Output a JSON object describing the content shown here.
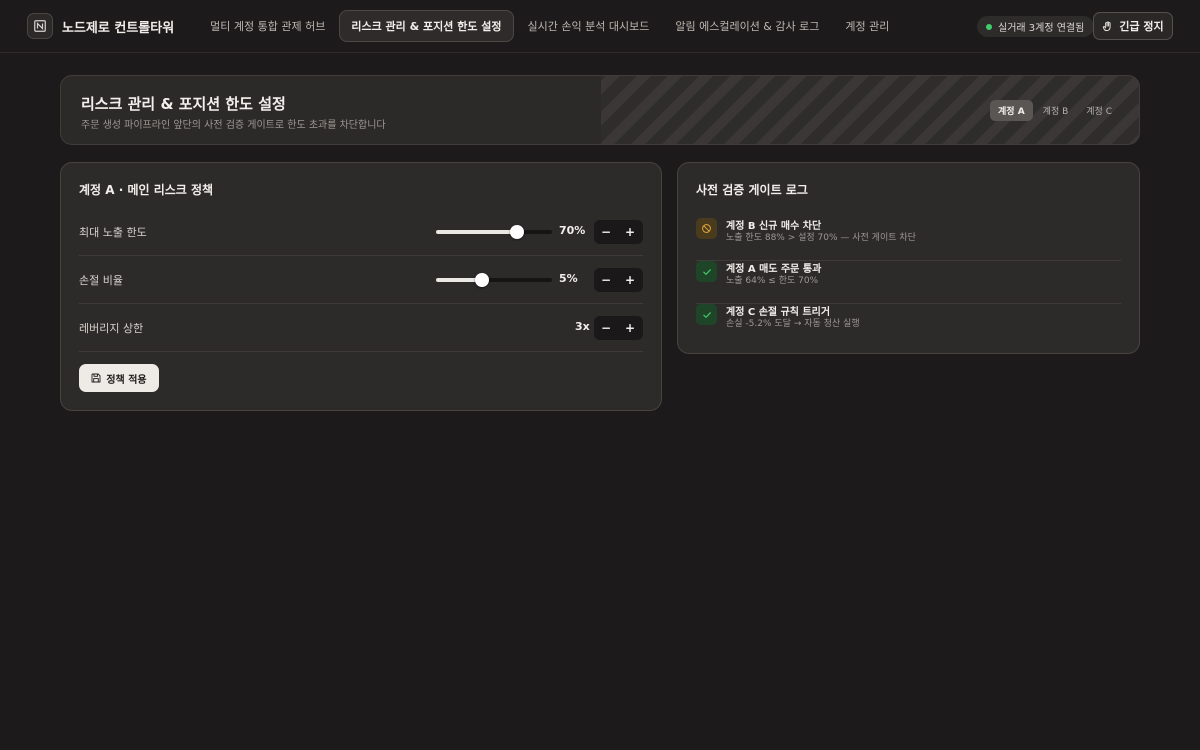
{
  "app": {
    "title": "노드제로 컨트롤타워"
  },
  "nav": {
    "items": [
      {
        "label": "멀티 계정 통합 관제 허브",
        "active": false
      },
      {
        "label": "리스크 관리 & 포지션 한도 설정",
        "active": true
      },
      {
        "label": "실시간 손익 분석 대시보드",
        "active": false
      },
      {
        "label": "알림 에스컬레이션 & 감사 로그",
        "active": false
      },
      {
        "label": "계정 관리",
        "active": false
      }
    ]
  },
  "status": {
    "label": "실거래 3계정 연결됨",
    "color": "#3ecf6a"
  },
  "emergency": {
    "label": "긴급 정지",
    "icon": "hand-stop-icon"
  },
  "header": {
    "title": "리스크 관리 & 포지션 한도 설정",
    "subtitle": "주문 생성 파이프라인 앞단의 사전 검증 게이트로 한도 초과를 차단합니다",
    "account_tabs": [
      {
        "label": "계정 A",
        "active": true
      },
      {
        "label": "계정 B",
        "active": false
      },
      {
        "label": "계정 C",
        "active": false
      }
    ]
  },
  "policy": {
    "title": "계정 A · 메인 리스크 정책",
    "rows": [
      {
        "label": "최대 노출 한도",
        "value": "70%",
        "level": 0.7
      },
      {
        "label": "손절 비율",
        "value": "5%",
        "level": 0.4
      },
      {
        "label": "레버리지 상한",
        "value": "3x"
      }
    ],
    "stepper_minus": "−",
    "stepper_plus": "+",
    "apply_label": "정책 적용",
    "apply_icon": "save-icon"
  },
  "gate_log": {
    "title": "사전 검증 게이트 로그",
    "items": [
      {
        "title": "계정 B 신규 매수 차단",
        "desc": "노출 한도 88% > 설정 70% — 사전 게이트 차단",
        "icon": "block-icon",
        "status": "blocked",
        "color": "#d9a23c"
      },
      {
        "title": "계정 A 매도 주문 통과",
        "desc": "노출 64% ≤ 한도 70%",
        "icon": "check-icon",
        "status": "passed",
        "color": "#46c46a"
      },
      {
        "title": "계정 C 손절 규칙 트리거",
        "desc": "손실 -5.2% 도달 → 자동 청산 실행",
        "icon": "check-icon",
        "status": "passed",
        "color": "#46c46a"
      }
    ]
  }
}
